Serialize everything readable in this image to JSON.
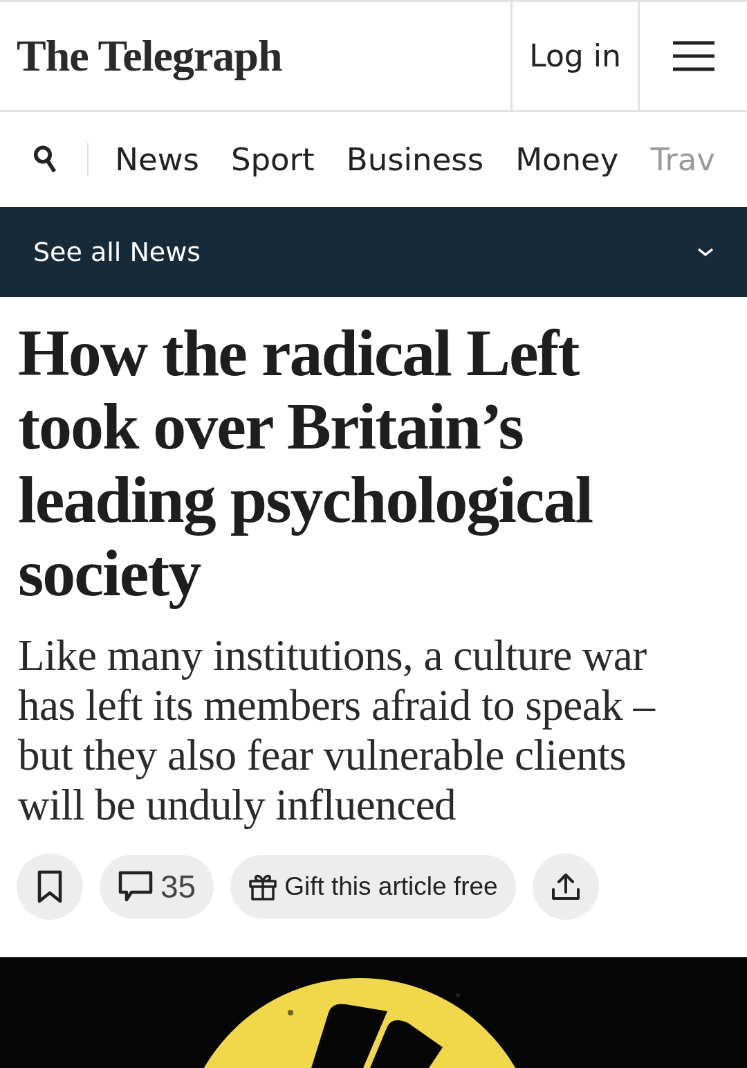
{
  "header": {
    "logo": "The Telegraph",
    "login": "Log in"
  },
  "nav": {
    "items": [
      {
        "label": "News",
        "faded": false
      },
      {
        "label": "Sport",
        "faded": false
      },
      {
        "label": "Business",
        "faded": false
      },
      {
        "label": "Money",
        "faded": false
      },
      {
        "label": "Trav",
        "faded": true
      }
    ]
  },
  "section_bar": {
    "label": "See all News",
    "expanded": false
  },
  "article": {
    "headline": "How the radical Left took over Britain’s leading psychological society",
    "standfirst": "Like many institutions, a culture war has left its members afraid to speak – but they also fear vulnerable clients will be unduly influenced",
    "actions": {
      "comments": "35",
      "gift": "Gift this article free"
    }
  }
}
